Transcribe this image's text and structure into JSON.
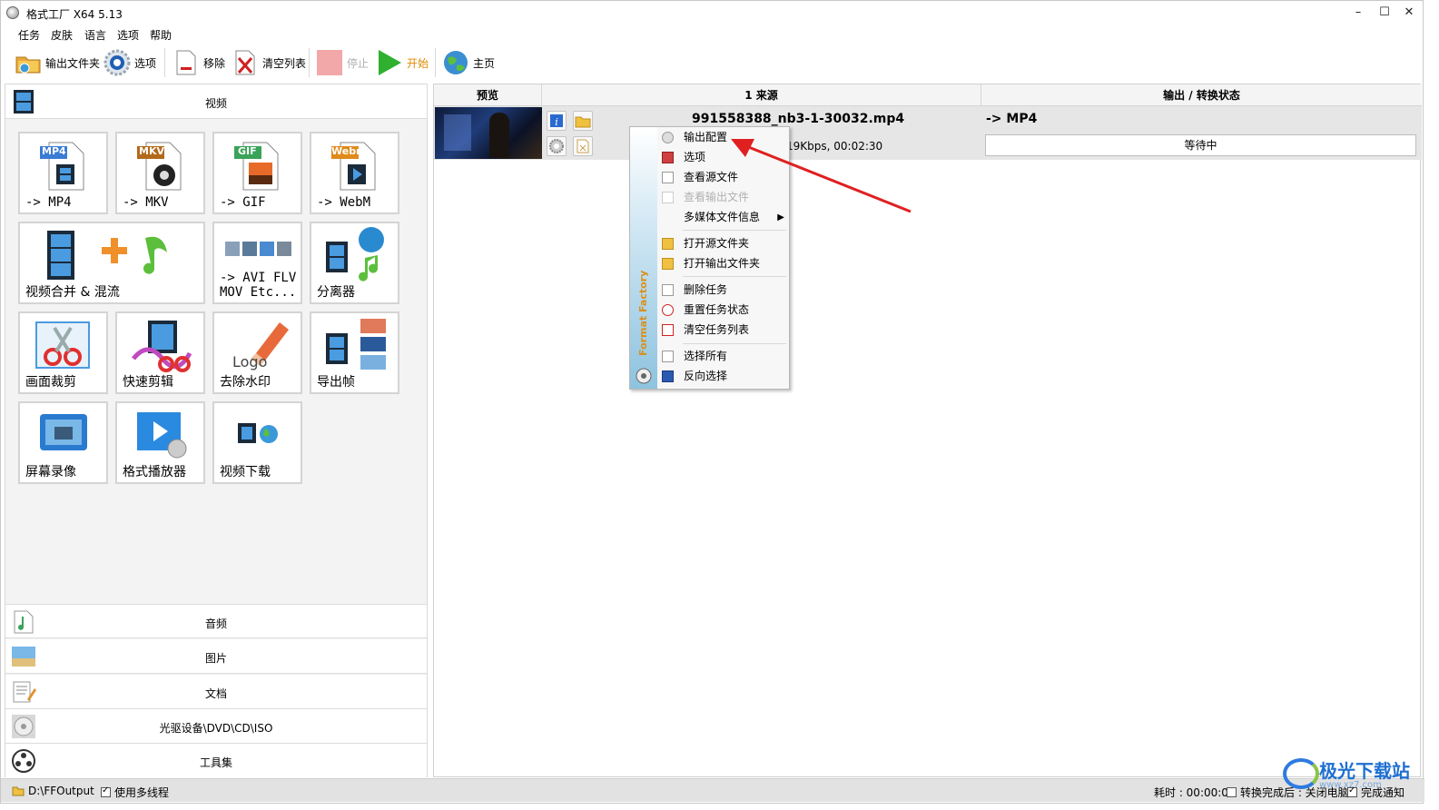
{
  "window": {
    "title": "格式工厂 X64 5.13",
    "minimize": "–",
    "maximize": "☐",
    "close": "✕"
  },
  "menu": [
    "任务",
    "皮肤",
    "语言",
    "选项",
    "帮助"
  ],
  "toolbar": {
    "output_folder": "输出文件夹",
    "options": "选项",
    "remove": "移除",
    "clear_list": "清空列表",
    "stop": "停止",
    "start": "开始",
    "home": "主页"
  },
  "categories": {
    "video": "视频",
    "audio": "音频",
    "picture": "图片",
    "document": "文档",
    "disc": "光驱设备\\DVD\\CD\\ISO",
    "tools": "工具集"
  },
  "video_tiles": [
    {
      "label": "-> MP4",
      "badge": "MP4"
    },
    {
      "label": "-> MKV",
      "badge": "MKV"
    },
    {
      "label": "-> GIF",
      "badge": "GIF"
    },
    {
      "label": "-> WebM",
      "badge": "Webm"
    },
    {
      "label": "视频合并 & 混流"
    },
    {
      "label": "-> AVI FLV\nMOV Etc..."
    },
    {
      "label": "分离器"
    },
    {
      "label": "画面裁剪"
    },
    {
      "label": "快速剪辑"
    },
    {
      "label": "去除水印",
      "logo_text": "Logo"
    },
    {
      "label": "导出帧"
    },
    {
      "label": "屏幕录像"
    },
    {
      "label": "格式播放器"
    },
    {
      "label": "视频下载"
    }
  ],
  "task_list": {
    "headers": {
      "preview": "预览",
      "source": "1 来源",
      "output": "输出 / 转换状态"
    },
    "row": {
      "filename": "991558388_nb3-1-30032.mp4",
      "info": "19Kbps, 00:02:30",
      "output_format": "-> MP4",
      "status": "等待中"
    }
  },
  "context_menu": {
    "brand": "Format Factory",
    "items": [
      {
        "label": "输出配置",
        "enabled": true
      },
      {
        "label": "选项",
        "enabled": true
      },
      {
        "label": "查看源文件",
        "enabled": true
      },
      {
        "label": "查看输出文件",
        "enabled": false
      },
      {
        "label": "多媒体文件信息",
        "enabled": true,
        "submenu": true
      },
      {
        "label": "打开源文件夹",
        "enabled": true
      },
      {
        "label": "打开输出文件夹",
        "enabled": true
      },
      {
        "label": "删除任务",
        "enabled": true
      },
      {
        "label": "重置任务状态",
        "enabled": true
      },
      {
        "label": "清空任务列表",
        "enabled": true
      },
      {
        "label": "选择所有",
        "enabled": true
      },
      {
        "label": "反向选择",
        "enabled": true
      }
    ]
  },
  "statusbar": {
    "output_path": "D:\\FFOutput",
    "multithread_label": "使用多线程",
    "multithread": true,
    "elapsed": "耗时 : 00:00:00",
    "after_done_label": "转换完成后 : 关闭电脑",
    "after_done": false,
    "notify_label": "完成通知",
    "notify": true
  },
  "watermark": {
    "text": "极光下载站",
    "url": "www.xz7.com"
  },
  "colors": {
    "accent_arrow": "#e02020",
    "start_green": "#2fb02f",
    "brand_orange": "#d9901a"
  }
}
